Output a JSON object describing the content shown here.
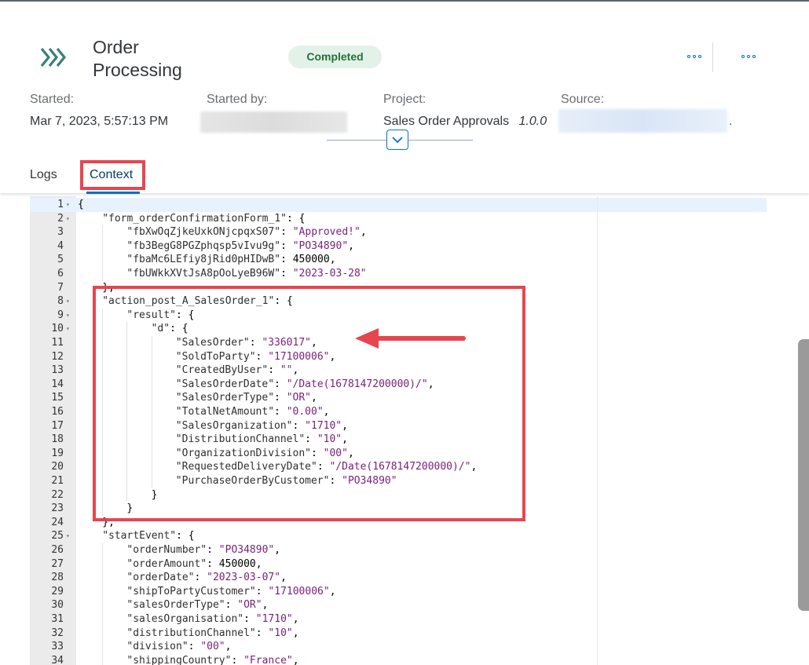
{
  "header": {
    "title_line1": "Order",
    "title_line2": "Processing",
    "status": "Completed",
    "logo_icon": "double-chevron-right-icon",
    "accent_color": "#0a6ed1",
    "meta": {
      "started_label": "Started:",
      "started_value": "Mar 7, 2023, 5:57:13 PM",
      "started_by_label": "Started by:",
      "project_label": "Project:",
      "project_value": "Sales Order Approvals",
      "project_version": "1.0.0",
      "source_label": "Source:",
      "source_suffix": "."
    }
  },
  "tabs": [
    {
      "label": "Logs"
    },
    {
      "label": "Context"
    }
  ],
  "editor": {
    "lines": [
      {
        "n": "1",
        "fold": true,
        "indent": 0,
        "parts": [
          [
            "p",
            "{"
          ]
        ]
      },
      {
        "n": "2",
        "fold": true,
        "indent": 1,
        "parts": [
          [
            "k",
            "\"form_orderConfirmationForm_1\""
          ],
          [
            "p",
            ": {"
          ]
        ]
      },
      {
        "n": "3",
        "fold": false,
        "indent": 2,
        "parts": [
          [
            "k",
            "\"fbXwOqZjkeUxkONjcpqxS07\""
          ],
          [
            "p",
            ": "
          ],
          [
            "s",
            "\"Approved!\""
          ],
          [
            "p",
            ","
          ]
        ]
      },
      {
        "n": "4",
        "fold": false,
        "indent": 2,
        "parts": [
          [
            "k",
            "\"fb3BegG8PGZphqsp5vIvu9g\""
          ],
          [
            "p",
            ": "
          ],
          [
            "s",
            "\"PO34890\""
          ],
          [
            "p",
            ","
          ]
        ]
      },
      {
        "n": "5",
        "fold": false,
        "indent": 2,
        "parts": [
          [
            "k",
            "\"fbaMc6LEfiy8jRid0pHIDwB\""
          ],
          [
            "p",
            ": "
          ],
          [
            "n",
            "450000"
          ],
          [
            "p",
            ","
          ]
        ]
      },
      {
        "n": "6",
        "fold": false,
        "indent": 2,
        "parts": [
          [
            "k",
            "\"fbUWkkXVtJsA8pOoLyeB96W\""
          ],
          [
            "p",
            ": "
          ],
          [
            "s",
            "\"2023-03-28\""
          ]
        ]
      },
      {
        "n": "7",
        "fold": false,
        "indent": 1,
        "parts": [
          [
            "p",
            "},"
          ]
        ]
      },
      {
        "n": "8",
        "fold": true,
        "indent": 1,
        "parts": [
          [
            "k",
            "\"action_post_A_SalesOrder_1\""
          ],
          [
            "p",
            ": {"
          ]
        ]
      },
      {
        "n": "9",
        "fold": true,
        "indent": 2,
        "parts": [
          [
            "k",
            "\"result\""
          ],
          [
            "p",
            ": {"
          ]
        ]
      },
      {
        "n": "10",
        "fold": true,
        "indent": 3,
        "parts": [
          [
            "k",
            "\"d\""
          ],
          [
            "p",
            ": {"
          ]
        ]
      },
      {
        "n": "11",
        "fold": false,
        "indent": 4,
        "parts": [
          [
            "k",
            "\"SalesOrder\""
          ],
          [
            "p",
            ": "
          ],
          [
            "s",
            "\"336017\""
          ],
          [
            "p",
            ","
          ]
        ]
      },
      {
        "n": "12",
        "fold": false,
        "indent": 4,
        "parts": [
          [
            "k",
            "\"SoldToParty\""
          ],
          [
            "p",
            ": "
          ],
          [
            "s",
            "\"17100006\""
          ],
          [
            "p",
            ","
          ]
        ]
      },
      {
        "n": "13",
        "fold": false,
        "indent": 4,
        "parts": [
          [
            "k",
            "\"CreatedByUser\""
          ],
          [
            "p",
            ": "
          ],
          [
            "s",
            "\"\""
          ],
          [
            "p",
            ","
          ]
        ]
      },
      {
        "n": "14",
        "fold": false,
        "indent": 4,
        "parts": [
          [
            "k",
            "\"SalesOrderDate\""
          ],
          [
            "p",
            ": "
          ],
          [
            "s",
            "\"/Date(1678147200000)/\""
          ],
          [
            "p",
            ","
          ]
        ]
      },
      {
        "n": "15",
        "fold": false,
        "indent": 4,
        "parts": [
          [
            "k",
            "\"SalesOrderType\""
          ],
          [
            "p",
            ": "
          ],
          [
            "s",
            "\"OR\""
          ],
          [
            "p",
            ","
          ]
        ]
      },
      {
        "n": "16",
        "fold": false,
        "indent": 4,
        "parts": [
          [
            "k",
            "\"TotalNetAmount\""
          ],
          [
            "p",
            ": "
          ],
          [
            "s",
            "\"0.00\""
          ],
          [
            "p",
            ","
          ]
        ]
      },
      {
        "n": "17",
        "fold": false,
        "indent": 4,
        "parts": [
          [
            "k",
            "\"SalesOrganization\""
          ],
          [
            "p",
            ": "
          ],
          [
            "s",
            "\"1710\""
          ],
          [
            "p",
            ","
          ]
        ]
      },
      {
        "n": "18",
        "fold": false,
        "indent": 4,
        "parts": [
          [
            "k",
            "\"DistributionChannel\""
          ],
          [
            "p",
            ": "
          ],
          [
            "s",
            "\"10\""
          ],
          [
            "p",
            ","
          ]
        ]
      },
      {
        "n": "19",
        "fold": false,
        "indent": 4,
        "parts": [
          [
            "k",
            "\"OrganizationDivision\""
          ],
          [
            "p",
            ": "
          ],
          [
            "s",
            "\"00\""
          ],
          [
            "p",
            ","
          ]
        ]
      },
      {
        "n": "20",
        "fold": false,
        "indent": 4,
        "parts": [
          [
            "k",
            "\"RequestedDeliveryDate\""
          ],
          [
            "p",
            ": "
          ],
          [
            "s",
            "\"/Date(1678147200000)/\""
          ],
          [
            "p",
            ","
          ]
        ]
      },
      {
        "n": "21",
        "fold": false,
        "indent": 4,
        "parts": [
          [
            "k",
            "\"PurchaseOrderByCustomer\""
          ],
          [
            "p",
            ": "
          ],
          [
            "s",
            "\"PO34890\""
          ]
        ]
      },
      {
        "n": "22",
        "fold": false,
        "indent": 3,
        "parts": [
          [
            "p",
            "}"
          ]
        ]
      },
      {
        "n": "23",
        "fold": false,
        "indent": 2,
        "parts": [
          [
            "p",
            "}"
          ]
        ]
      },
      {
        "n": "24",
        "fold": false,
        "indent": 1,
        "parts": [
          [
            "p",
            "},"
          ]
        ]
      },
      {
        "n": "25",
        "fold": true,
        "indent": 1,
        "parts": [
          [
            "k",
            "\"startEvent\""
          ],
          [
            "p",
            ": {"
          ]
        ]
      },
      {
        "n": "26",
        "fold": false,
        "indent": 2,
        "parts": [
          [
            "k",
            "\"orderNumber\""
          ],
          [
            "p",
            ": "
          ],
          [
            "s",
            "\"PO34890\""
          ],
          [
            "p",
            ","
          ]
        ]
      },
      {
        "n": "27",
        "fold": false,
        "indent": 2,
        "parts": [
          [
            "k",
            "\"orderAmount\""
          ],
          [
            "p",
            ": "
          ],
          [
            "n",
            "450000"
          ],
          [
            "p",
            ","
          ]
        ]
      },
      {
        "n": "28",
        "fold": false,
        "indent": 2,
        "parts": [
          [
            "k",
            "\"orderDate\""
          ],
          [
            "p",
            ": "
          ],
          [
            "s",
            "\"2023-03-07\""
          ],
          [
            "p",
            ","
          ]
        ]
      },
      {
        "n": "29",
        "fold": false,
        "indent": 2,
        "parts": [
          [
            "k",
            "\"shipToPartyCustomer\""
          ],
          [
            "p",
            ": "
          ],
          [
            "s",
            "\"17100006\""
          ],
          [
            "p",
            ","
          ]
        ]
      },
      {
        "n": "30",
        "fold": false,
        "indent": 2,
        "parts": [
          [
            "k",
            "\"salesOrderType\""
          ],
          [
            "p",
            ": "
          ],
          [
            "s",
            "\"OR\""
          ],
          [
            "p",
            ","
          ]
        ]
      },
      {
        "n": "31",
        "fold": false,
        "indent": 2,
        "parts": [
          [
            "k",
            "\"salesOrganisation\""
          ],
          [
            "p",
            ": "
          ],
          [
            "s",
            "\"1710\""
          ],
          [
            "p",
            ","
          ]
        ]
      },
      {
        "n": "32",
        "fold": false,
        "indent": 2,
        "parts": [
          [
            "k",
            "\"distributionChannel\""
          ],
          [
            "p",
            ": "
          ],
          [
            "s",
            "\"10\""
          ],
          [
            "p",
            ","
          ]
        ]
      },
      {
        "n": "33",
        "fold": false,
        "indent": 2,
        "parts": [
          [
            "k",
            "\"division\""
          ],
          [
            "p",
            ": "
          ],
          [
            "s",
            "\"00\""
          ],
          [
            "p",
            ","
          ]
        ]
      },
      {
        "n": "34",
        "fold": false,
        "indent": 2,
        "parts": [
          [
            "k",
            "\"shippingCountry\""
          ],
          [
            "p",
            ": "
          ],
          [
            "s",
            "\"France\""
          ],
          [
            "p",
            ","
          ]
        ]
      }
    ]
  }
}
